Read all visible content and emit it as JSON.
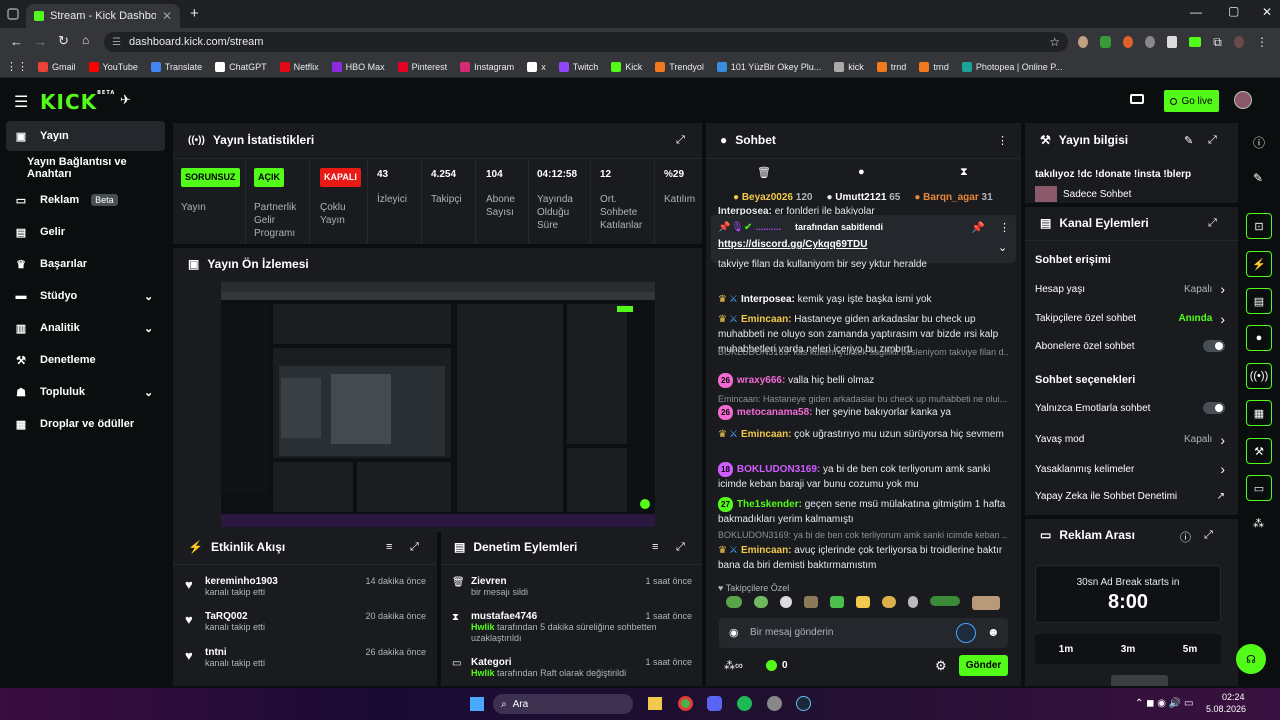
{
  "browser": {
    "tab_title": "Stream - Kick Dashboard",
    "url": "dashboard.kick.com/stream",
    "bookmarks": [
      {
        "label": "Gmail",
        "color": "#ea4335"
      },
      {
        "label": "YouTube",
        "color": "#ff0000"
      },
      {
        "label": "Translate",
        "color": "#4285f4"
      },
      {
        "label": "ChatGPT",
        "color": "#ffffff"
      },
      {
        "label": "Netflix",
        "color": "#e50914"
      },
      {
        "label": "HBO Max",
        "color": "#8a2be2"
      },
      {
        "label": "Pinterest",
        "color": "#e60023"
      },
      {
        "label": "Instagram",
        "color": "#d62976"
      },
      {
        "label": "x",
        "color": "#ffffff"
      },
      {
        "label": "Twitch",
        "color": "#9146ff"
      },
      {
        "label": "Kick",
        "color": "#53fc18"
      },
      {
        "label": "Trendyol",
        "color": "#f27a1a"
      },
      {
        "label": "101 YüzBir Okey Plu...",
        "color": "#3a8dde"
      },
      {
        "label": "kick",
        "color": "#aaaaaa"
      },
      {
        "label": "trnd",
        "color": "#f27a1a"
      },
      {
        "label": "trnd",
        "color": "#f27a1a"
      },
      {
        "label": "Photopea | Online P...",
        "color": "#18a497"
      }
    ]
  },
  "header": {
    "logo": "KICK",
    "logo_sup": "BETA",
    "go_live": "Go live"
  },
  "sidebar": {
    "items": [
      {
        "label": "Yayın"
      },
      {
        "label": "Yayın Bağlantısı ve Anahtarı"
      },
      {
        "label": "Reklam",
        "badge": "Beta"
      },
      {
        "label": "Gelir"
      },
      {
        "label": "Başarılar"
      },
      {
        "label": "Stüdyo"
      },
      {
        "label": "Analitik"
      },
      {
        "label": "Denetleme"
      },
      {
        "label": "Topluluk"
      },
      {
        "label": "Droplar ve ödüller"
      }
    ]
  },
  "stats": {
    "title": "Yayın İstatistikleri",
    "items": [
      {
        "value": "SORUNSUZ",
        "label": "Yayın"
      },
      {
        "value": "AÇIK",
        "label": "Partnerlik Gelir Programı"
      },
      {
        "value": "KAPALI",
        "label": "Çoklu Yayın"
      },
      {
        "value": "43",
        "label": "İzleyici"
      },
      {
        "value": "4.254",
        "label": "Takipçi"
      },
      {
        "value": "104",
        "label": "Abone Sayısı"
      },
      {
        "value": "04:12:58",
        "label": "Yayında Olduğu Süre"
      },
      {
        "value": "12",
        "label": "Ort. Sohbete Katılanlar"
      },
      {
        "value": "%29",
        "label": "Katılım"
      }
    ]
  },
  "preview": {
    "title": "Yayın Ön İzlemesi"
  },
  "activity": {
    "title": "Etkinlik Akışı",
    "items": [
      {
        "name": "kereminho1903",
        "text": "kanalı takip etti",
        "time": "14 dakika önce"
      },
      {
        "name": "TaRQ002",
        "text": "kanalı takip etti",
        "time": "20 dakika önce"
      },
      {
        "name": "tntni",
        "text": "kanalı takip etti",
        "time": "26 dakika önce"
      }
    ]
  },
  "moderation": {
    "title": "Denetim Eylemleri",
    "items": [
      {
        "name": "Zievren",
        "actor": "",
        "text": "bir mesajı sildi",
        "time": "1 saat önce"
      },
      {
        "name": "mustafae4746",
        "actor": "Hwlik",
        "text": "tarafından 5 dakika süreliğine sohbetten uzaklaştırıldı",
        "time": "1 saat önce"
      },
      {
        "name": "Kategori",
        "actor": "Hwlik",
        "text": "tarafından Raft olarak değiştirildi",
        "time": "1 saat önce"
      }
    ]
  },
  "chat": {
    "title": "Sohbet",
    "leaders": [
      {
        "name": "Beyaz0026",
        "count": "120",
        "color": "#f2c94c"
      },
      {
        "name": "Umutt2121",
        "count": "65",
        "color": "#e8eaed"
      },
      {
        "name": "Barqn_agar",
        "count": "31",
        "color": "#e8883a"
      }
    ],
    "pinned_by": "tarafından sabitlendi",
    "pinned_link": "https://discord.gg/Cykqq69TDU",
    "pinned_user": "Interposea:",
    "pinned_tail": "er fonlderi ile bakiyolar",
    "messages": [
      {
        "user": "",
        "text": "takviye filan da kullaniyom bir sey yktur heralde",
        "color": "#e8eaed"
      },
      {
        "user": "Interposea:",
        "text": "kemik yaşı işte başka ismi yok",
        "color": "#ffffff"
      },
      {
        "user": "Emincaan:",
        "text": "Hastaneye giden arkadaslar bu check up muhabbeti ne oluyo son zamanda yaptırasım var bizde ırsi kalp muhabbetleri varda neleri içeriyo bu zımbırtı",
        "color": "#f2c94c"
      },
      {
        "sys": "BOKLUDON3169: kas kutlem yuksek sagilikli besleniyom takviye filan d..."
      },
      {
        "badge": "26",
        "user": "wraxy666:",
        "text": "valla hiç belli olmaz",
        "color": "#f26ad4"
      },
      {
        "sys": "Emincaan: Hastaneye giden arkadaslar bu check up muhabbeti ne olui..."
      },
      {
        "badge": "26",
        "user": "metocanama58:",
        "text": "her şeyine bakıyorlar kanka ya",
        "color": "#f26ad4"
      },
      {
        "user": "Emincaan:",
        "text": "çok uğrastırıyo mu uzun sürüyorsa hiç sevmem",
        "color": "#f2c94c"
      },
      {
        "badge": "18",
        "user": "BOKLUDON3169:",
        "text": "ya bi de ben cok terliyorum amk sanki icimde keban baraji var bunu cozumu yok mu",
        "color": "#d15cff"
      },
      {
        "badge": "27",
        "user": "The1skender:",
        "text": "geçen sene msü mülakatına gitmiştim 1 hafta bakmadıkları yerim kalmamıştı",
        "color": "#53fc18"
      },
      {
        "sys": "BOKLUDON3169: ya bi de ben cok terliyorum amk sanki icimde keban ..."
      },
      {
        "user": "Emincaan:",
        "text": "avuç içlerinde çok terliyorsa bi troidlerine baktır bana da biri demisti baktırmamıstım",
        "color": "#f2c94c"
      }
    ],
    "followers_only": "Takipçilere Özel",
    "input_placeholder": "Bir mesaj gönderin",
    "points": "0",
    "send": "Gönder"
  },
  "stream_info": {
    "title": "Yayın bilgisi",
    "stream_title": "takılıyoz !dc !donate !insta !blerp",
    "category": "Sadece Sohbet"
  },
  "channel_actions": {
    "title": "Kanal Eylemleri",
    "chat_access": "Sohbet erişimi",
    "rows_access": [
      {
        "label": "Hesap yaşı",
        "value": "Kapalı",
        "kind": "chev"
      },
      {
        "label": "Takipçilere özel sohbet",
        "value": "Anında",
        "kind": "chev",
        "green": true
      },
      {
        "label": "Abonelere özel sohbet",
        "value": "",
        "kind": "toggle"
      }
    ],
    "chat_options": "Sohbet seçenekleri",
    "rows_options": [
      {
        "label": "Yalnızca Emotlarla sohbet",
        "value": "",
        "kind": "toggle"
      },
      {
        "label": "Yavaş mod",
        "value": "Kapalı",
        "kind": "chev"
      },
      {
        "label": "Yasaklanmış kelimeler",
        "value": "",
        "kind": "chev"
      },
      {
        "label": "Yapay Zeka ile Sohbet Denetimi",
        "value": "",
        "kind": "ext"
      }
    ]
  },
  "ad_break": {
    "title": "Reklam Arası",
    "starts": "30sn Ad Break starts in",
    "timer": "8:00",
    "options": [
      "1m",
      "3m",
      "5m"
    ]
  },
  "taskbar": {
    "search": "Ara",
    "time": "02:24",
    "date": "5.08.2026"
  },
  "colors": {
    "accent": "#53fc18",
    "panel": "#191b1f",
    "bg": "#0b0e0f"
  }
}
